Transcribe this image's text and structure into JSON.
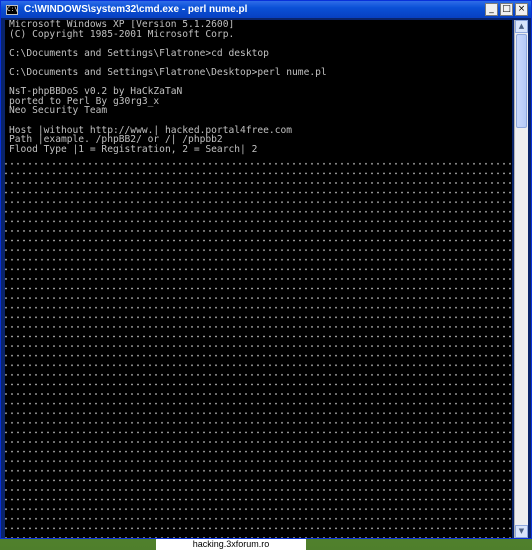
{
  "window": {
    "title": "C:\\WINDOWS\\system32\\cmd.exe - perl nume.pl",
    "icon_label": "C:\\",
    "minimize_glyph": "_",
    "maximize_glyph": "□",
    "close_glyph": "×"
  },
  "console": {
    "lines": [
      "Microsoft Windows XP [Version 5.1.2600]",
      "(C) Copyright 1985-2001 Microsoft Corp.",
      "",
      "C:\\Documents and Settings\\Flatrone>cd desktop",
      "",
      "C:\\Documents and Settings\\Flatrone\\Desktop>perl nume.pl",
      "",
      "NsT-phpBBDoS v0.2 by HaCkZaTaN",
      "ported to Perl By g30rg3_x",
      "Neo Security Team",
      "",
      "Host |without http://www.| hacked.portal4free.com",
      "Path |example. /phpBB2/ or /| /phpbb2",
      "Flood Type |1 = Registration, 2 = Search| 2"
    ],
    "progress_output": "....................................................................................."
  },
  "scrollbar": {
    "up_glyph": "▲",
    "down_glyph": "▼"
  },
  "watermark": {
    "text": "hacking.3xforum.ro"
  }
}
